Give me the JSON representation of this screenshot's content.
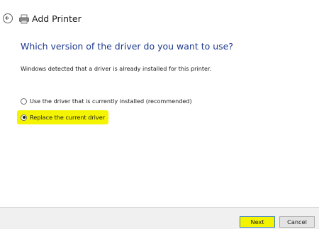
{
  "header": {
    "title": "Add Printer"
  },
  "main": {
    "heading": "Which version of the driver do you want to use?",
    "description": "Windows detected that a driver is already installed for this printer.",
    "options": [
      {
        "label": "Use the driver that is currently installed (recommended)",
        "selected": false
      },
      {
        "label": "Replace the current driver",
        "selected": true
      }
    ]
  },
  "footer": {
    "next_label": "Next",
    "cancel_label": "Cancel"
  },
  "colors": {
    "heading": "#1f3a8f",
    "highlight": "#f4f400",
    "footer_bg": "#f0f0f0"
  }
}
